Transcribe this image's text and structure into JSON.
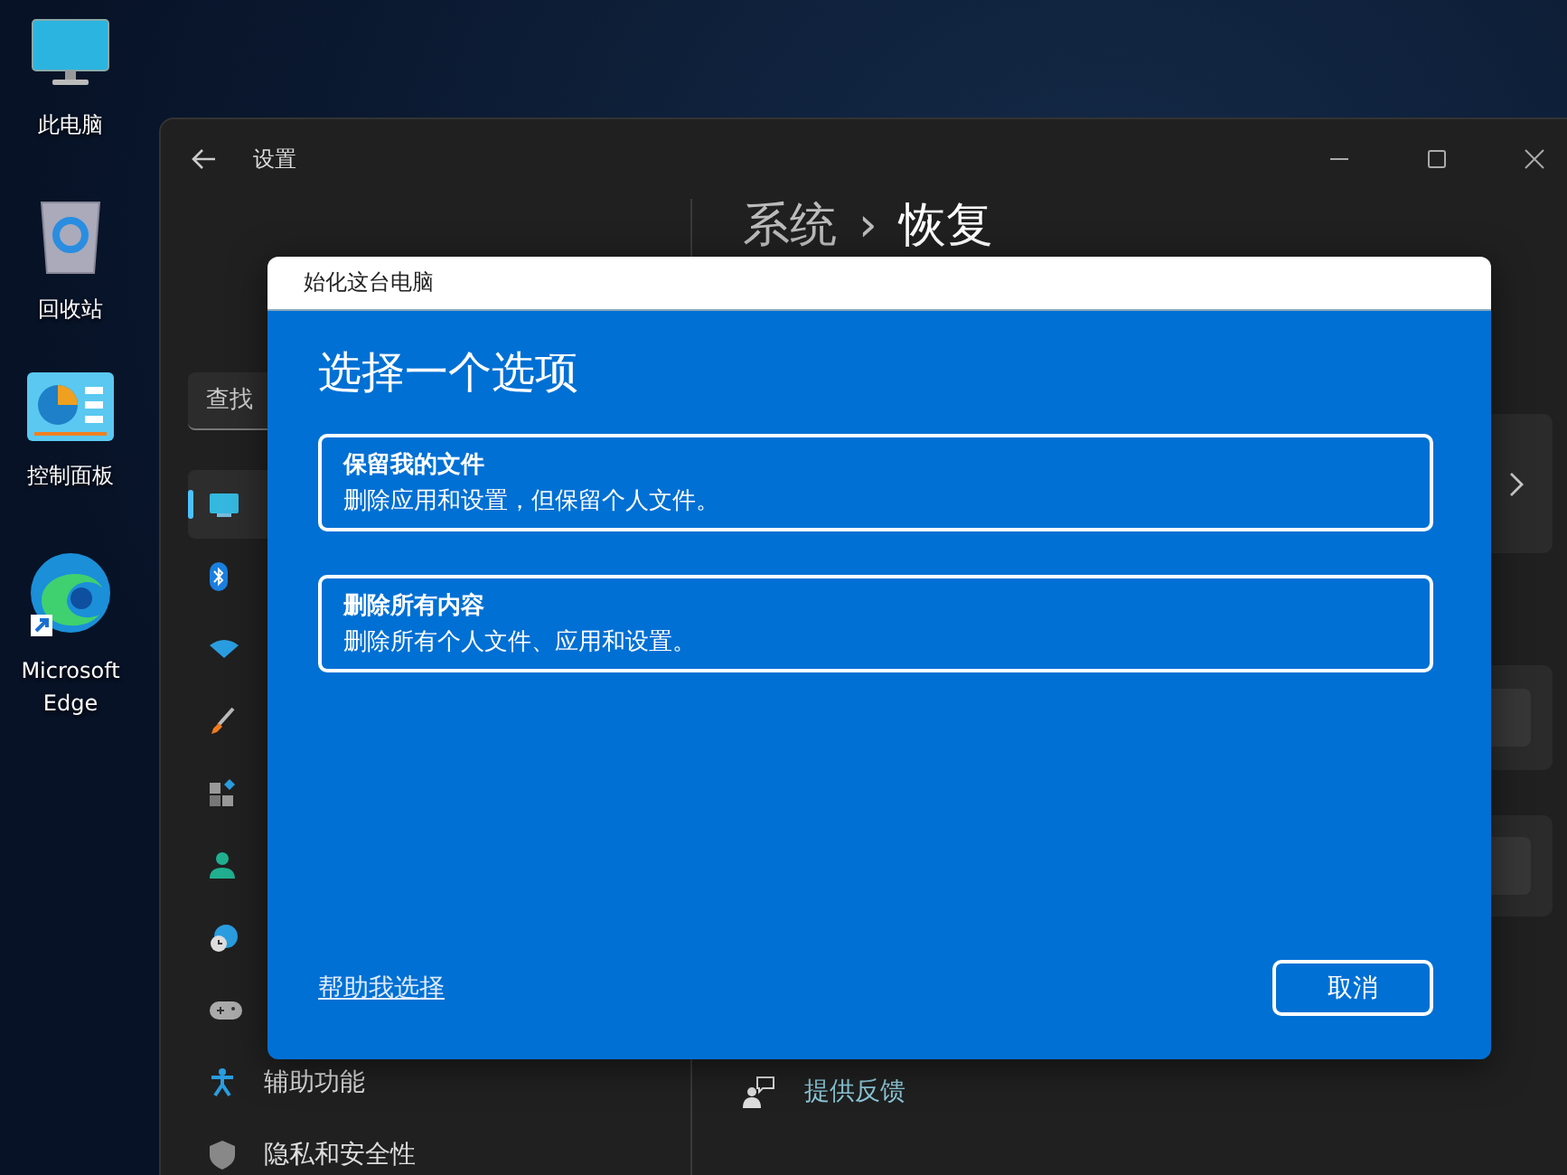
{
  "desktop_icons": [
    {
      "label": "此电脑"
    },
    {
      "label": "回收站"
    },
    {
      "label": "控制面板"
    },
    {
      "label": "Microsoft Edge"
    }
  ],
  "settings_window": {
    "title": "设置",
    "search": {
      "placeholder": "查找"
    },
    "breadcrumb": {
      "parent": "系统",
      "separator": "›",
      "current": "恢复"
    },
    "nav_items": [
      {
        "selected": true
      },
      {
        "selected": false
      },
      {
        "selected": false
      },
      {
        "selected": false
      },
      {
        "selected": false
      },
      {
        "selected": false
      },
      {
        "selected": false
      },
      {
        "selected": false
      },
      {
        "label": "辅助功能",
        "selected": false
      },
      {
        "label": "隐私和安全性",
        "selected": false
      }
    ],
    "feedback_link": "提供反馈"
  },
  "dialog": {
    "title": "始化这台电脑",
    "heading": "选择一个选项",
    "options": [
      {
        "title": "保留我的文件",
        "description": "删除应用和设置，但保留个人文件。"
      },
      {
        "title": "删除所有内容",
        "description": "删除所有个人文件、应用和设置。"
      }
    ],
    "help_link": "帮助我选择",
    "cancel_button": "取消"
  }
}
